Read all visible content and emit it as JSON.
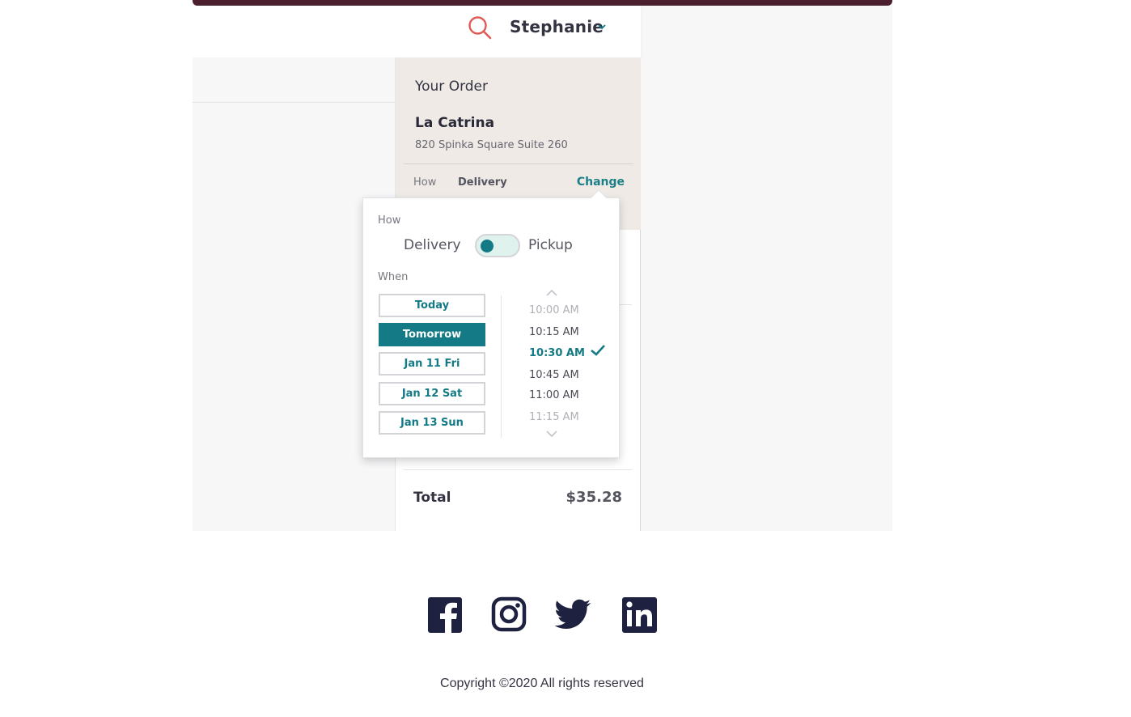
{
  "header": {
    "user_name": "Stephanie"
  },
  "order": {
    "title": "Your Order",
    "restaurant_name": "La Catrina",
    "restaurant_address": "820 Spinka Square Suite 260",
    "how_label": "How",
    "how_value": "Delivery",
    "change_label": "Change",
    "total_label": "Total",
    "total_value": "$35.28"
  },
  "popover": {
    "how_label": "How",
    "option_delivery": "Delivery",
    "option_pickup": "Pickup",
    "when_label": "When",
    "days": [
      {
        "label": "Today",
        "selected": false
      },
      {
        "label": "Tomorrow",
        "selected": true
      },
      {
        "label": "Jan 11 Fri",
        "selected": false
      },
      {
        "label": "Jan 12 Sat",
        "selected": false
      },
      {
        "label": "Jan 13 Sun",
        "selected": false
      }
    ],
    "times": [
      {
        "label": "10:00 AM",
        "state": "faded"
      },
      {
        "label": "10:15 AM",
        "state": "normal"
      },
      {
        "label": "10:30 AM",
        "state": "selected"
      },
      {
        "label": "10:45 AM",
        "state": "normal"
      },
      {
        "label": "11:00 AM",
        "state": "normal"
      },
      {
        "label": "11:15 AM",
        "state": "faded"
      }
    ]
  },
  "footer": {
    "copyright": "Copyright ©2020 All rights reserved",
    "socials": [
      "facebook-icon",
      "instagram-icon",
      "twitter-icon",
      "linkedin-icon"
    ]
  },
  "colors": {
    "accent": "#137a86",
    "brand_bar": "#4b1f2e",
    "search_icon": "#e05a55",
    "social_icons": "#1f2140"
  }
}
